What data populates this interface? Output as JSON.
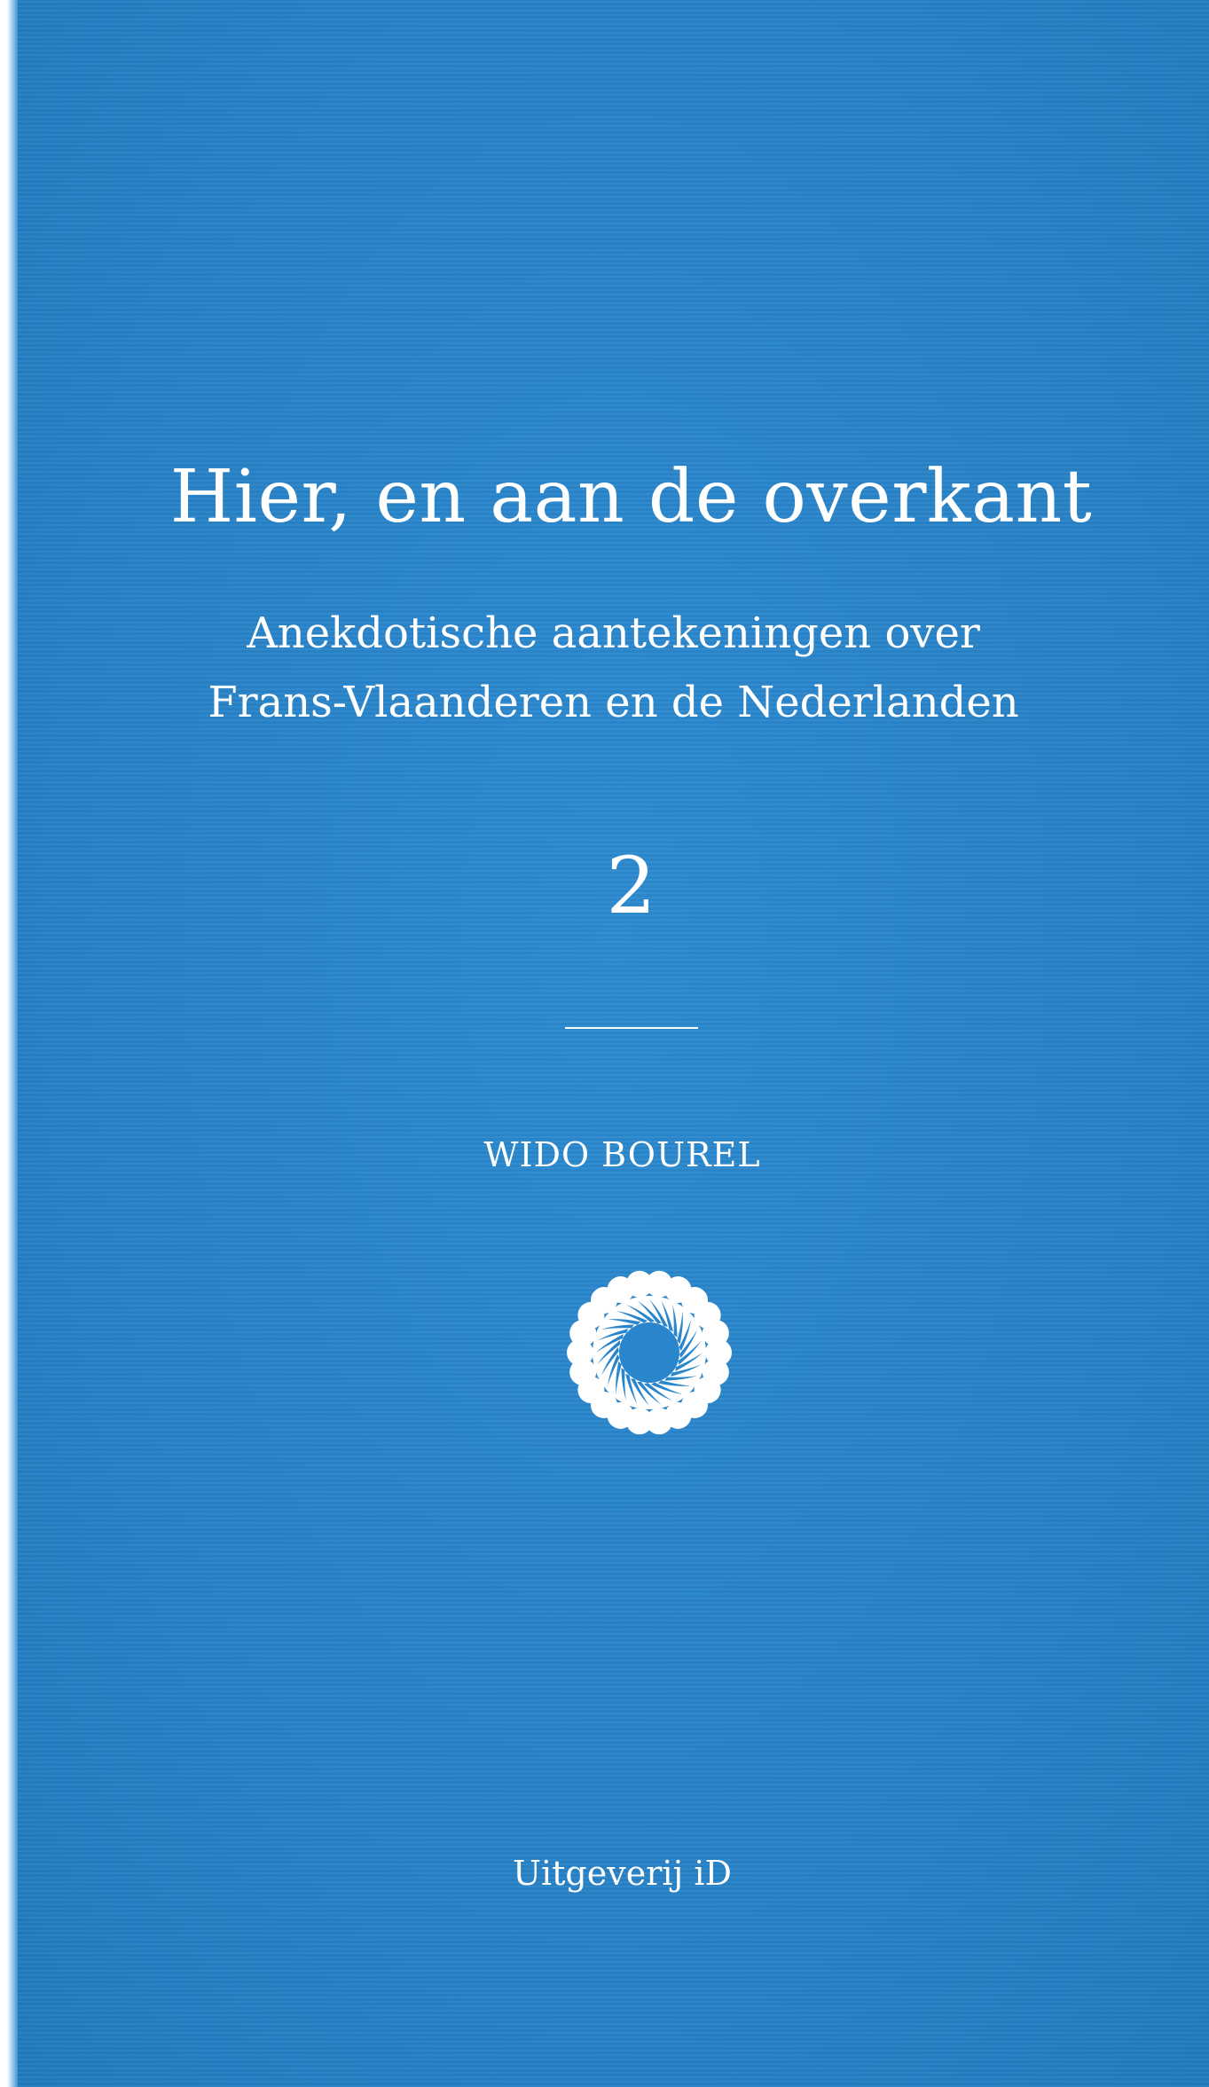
{
  "cover": {
    "title": "Hier, en aan de overkant",
    "subtitle_line_1": "Anekdotische aantekeningen over",
    "subtitle_line_2": "Frans-Vlaanderen en de Nederlanden",
    "volume": "2",
    "author": "WIDO BOUREL",
    "publisher": "Uitgeverij iD",
    "emblem_icon": "rosette-emblem-icon",
    "colors": {
      "background": "#2a86cc",
      "text": "#ffffff"
    }
  }
}
